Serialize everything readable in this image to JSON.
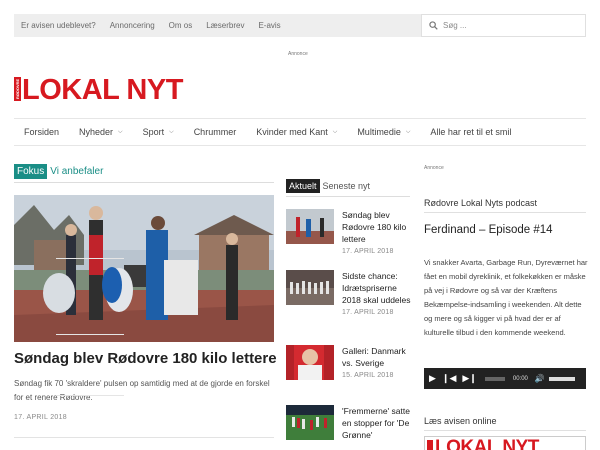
{
  "top_nav": {
    "links": [
      "Er avisen udeblevet?",
      "Annoncering",
      "Om os",
      "Læserbrev",
      "E-avis"
    ],
    "search_placeholder": "Søg ..."
  },
  "ad_label": "Annonce",
  "logo": {
    "vertical_text": "RØDOVRE",
    "text": "LOKAL NYT",
    "color": "#d71920"
  },
  "main_nav": [
    {
      "label": "Forsiden",
      "dropdown": false
    },
    {
      "label": "Nyheder",
      "dropdown": true
    },
    {
      "label": "Sport",
      "dropdown": true
    },
    {
      "label": "Chrummer",
      "dropdown": false
    },
    {
      "label": "Kvinder med Kant",
      "dropdown": true
    },
    {
      "label": "Multimedie",
      "dropdown": true
    },
    {
      "label": "Alle har ret til et smil",
      "dropdown": false
    }
  ],
  "focus": {
    "tag": "Fokus",
    "subtitle": "Vi anbefaler",
    "accent": "#1a8e86",
    "lead": {
      "title": "Søndag blev Rødovre 180 kilo lettere",
      "excerpt": "Søndag fik 70 'skraldere' pulsen op samtidig med at de gjorde en forskel for et renere Rødovre.",
      "date": "17. APRIL 2018"
    }
  },
  "aktuelt": {
    "tag": "Aktuelt",
    "subtitle": "Seneste nyt",
    "items": [
      {
        "title": "Søndag blev Rødovre 180 kilo lettere",
        "date": "17. APRIL 2018"
      },
      {
        "title": "Sidste chance: Idrætspriserne 2018 skal uddeles",
        "date": "17. APRIL 2018"
      },
      {
        "title": "Galleri: Danmark vs. Sverige",
        "date": "15. APRIL 2018"
      },
      {
        "title": "'Fremmerne' satte en stopper for 'De Grønne'",
        "date": ""
      }
    ]
  },
  "sidebar": {
    "ad_label": "Annonce",
    "podcast_title": "Rødovre Lokal Nyts podcast",
    "episode": "Ferdinand – Episode #14",
    "description": "Vi snakker Avarta, Garbage Run, Dyreværnet har fået en mobil dyreklinik, et folkekøkken er måske på vej i Rødovre og så var der Kræftens Bekæmpelse-indsamling i weekenden. Alt dette og mere og så kigger vi på hvad der er af kulturelle tilbud i den kommende weekend.",
    "player": {
      "time": "00:00"
    },
    "read_title": "Læs avisen online",
    "paper_logo": "LOKAL NYT"
  }
}
